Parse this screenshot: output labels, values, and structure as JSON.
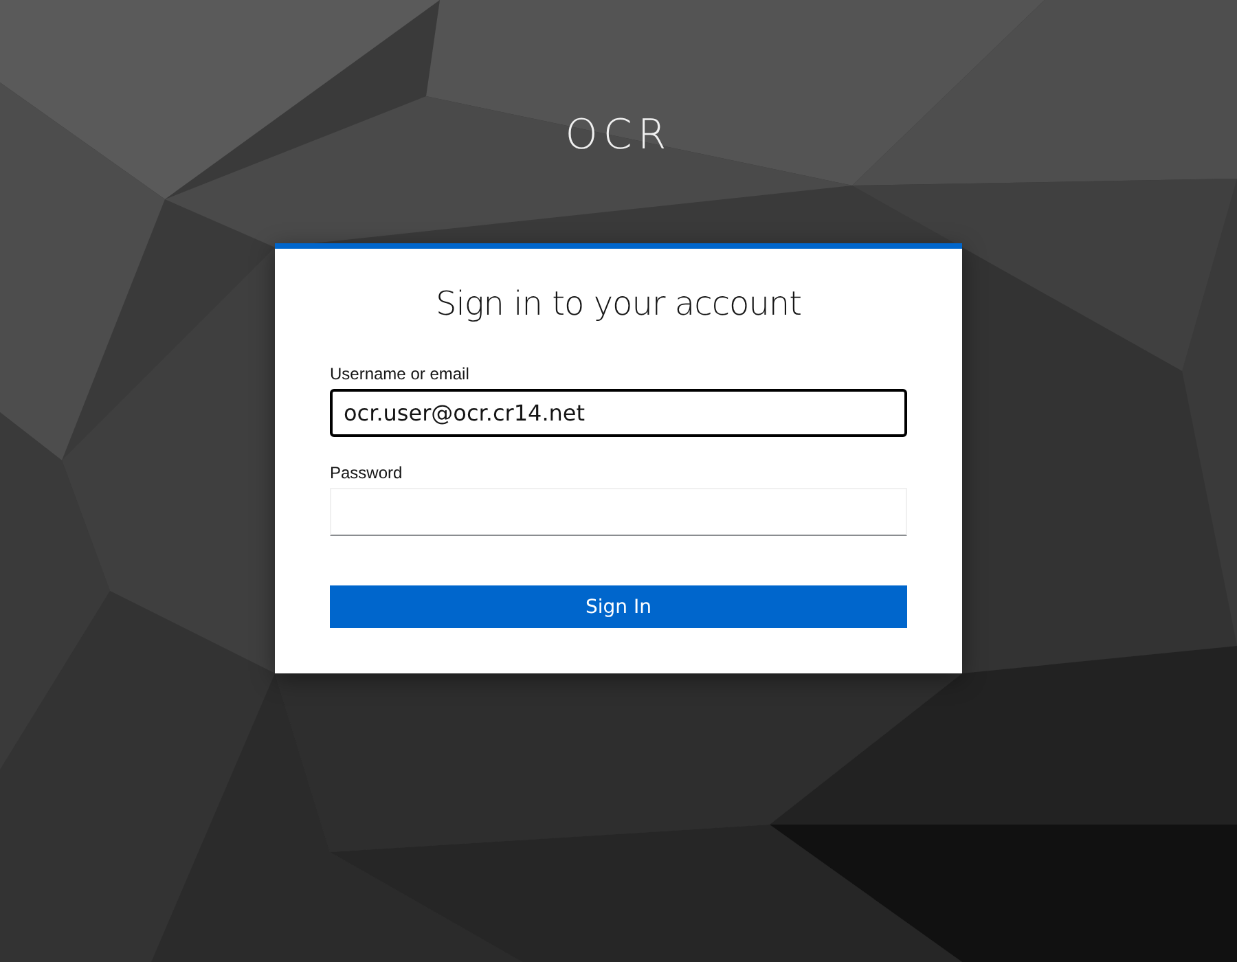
{
  "brand": "OCR",
  "card": {
    "title": "Sign in to your account",
    "fields": [
      {
        "label": "Username or email",
        "value": "ocr.user@ocr.cr14.net",
        "focused": true
      },
      {
        "label": "Password",
        "focused": false
      }
    ],
    "button": "Sign In"
  }
}
